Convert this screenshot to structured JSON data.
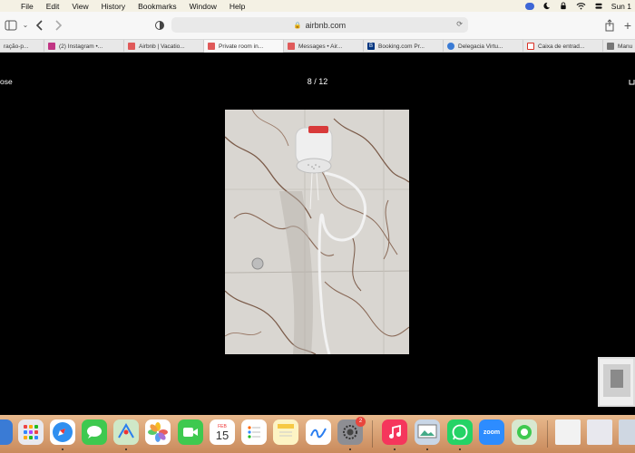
{
  "menubar": {
    "items": [
      "File",
      "Edit",
      "View",
      "History",
      "Bookmarks",
      "Window",
      "Help"
    ],
    "clock": "Sun 1"
  },
  "toolbar": {
    "url": "airbnb.com"
  },
  "tabs": [
    {
      "label": "ração-p...",
      "favicon_color": "#cccccc"
    },
    {
      "label": "(2) Instagram •...",
      "favicon_color": "#c13584"
    },
    {
      "label": "Airbnb | Vacatio...",
      "favicon_color": "#e05a5a"
    },
    {
      "label": "Private room in...",
      "favicon_color": "#e05a5a"
    },
    {
      "label": "Messages • Air...",
      "favicon_color": "#e05a5a"
    },
    {
      "label": "Booking.com Pr...",
      "favicon_color": "#003580"
    },
    {
      "label": "Delegacia Virtu...",
      "favicon_color": "#3a7bd5"
    },
    {
      "label": "Caixa de entrad...",
      "favicon_color": "#d93025"
    },
    {
      "label": "Manu",
      "favicon_color": "#777777"
    }
  ],
  "viewer": {
    "close_label": "ose",
    "counter": "8 / 12"
  },
  "dock": {
    "calendar_month": "FEB",
    "calendar_day": "15",
    "settings_badge": "2",
    "zoom_label": "zoom",
    "apps": [
      "Launchpad",
      "Safari",
      "Messages",
      "Maps",
      "Photos",
      "FaceTime",
      "Calendar",
      "Reminders",
      "Notes",
      "Freeform",
      "System Settings",
      "Music",
      "Preview",
      "WhatsApp",
      "Zoom",
      "Find My"
    ]
  }
}
